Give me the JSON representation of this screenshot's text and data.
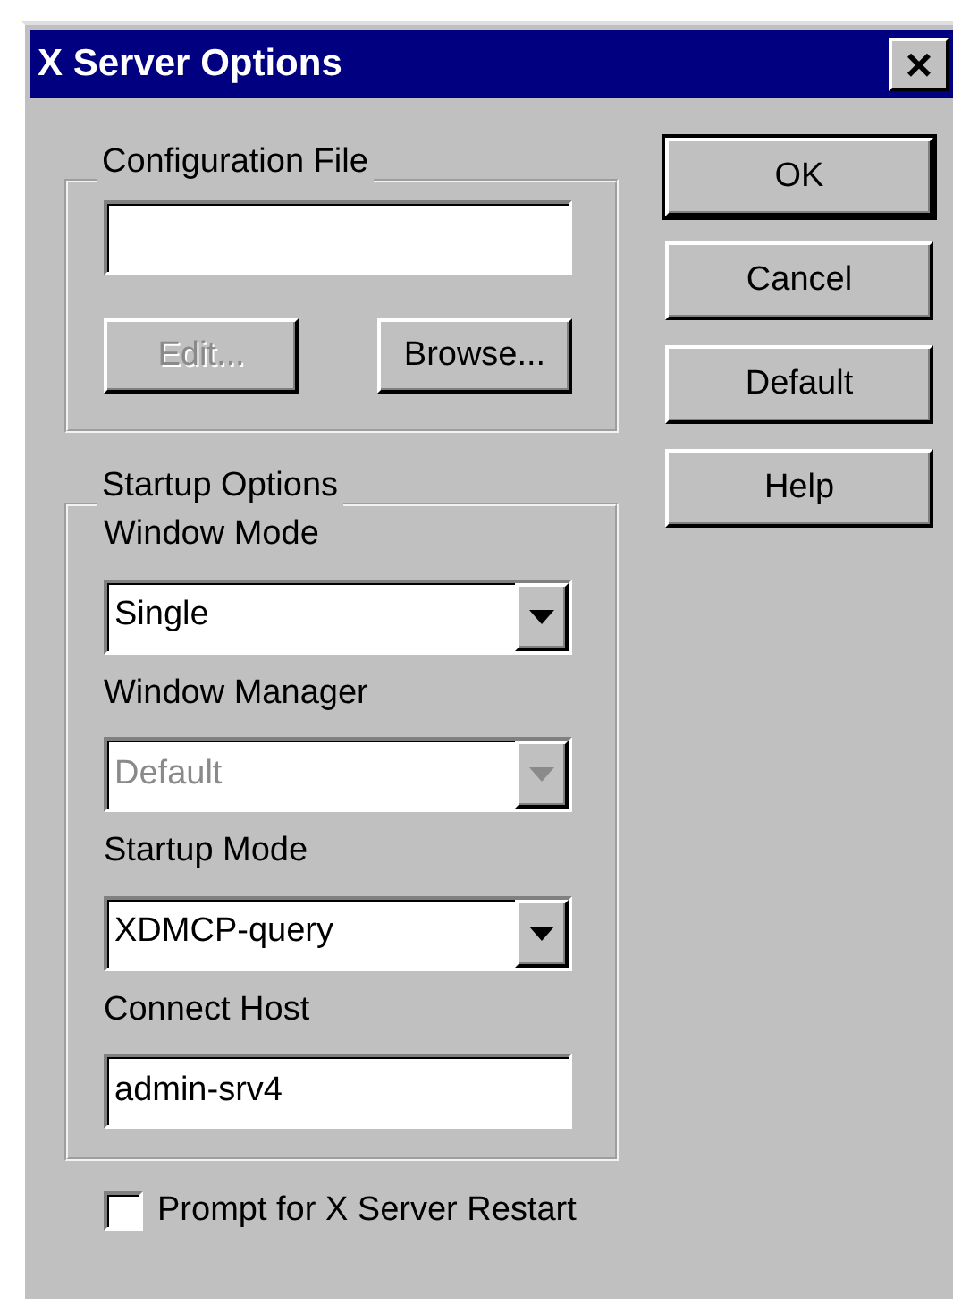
{
  "window": {
    "title": "X Server Options",
    "close": "×"
  },
  "configuration_file": {
    "legend": "Configuration File",
    "buttons": [
      {
        "label": "Edit...",
        "disabled": true
      },
      {
        "label": "Browse...",
        "disabled": false
      }
    ]
  },
  "dialog_buttons": [
    {
      "label": "OK",
      "default": true
    },
    {
      "label": "Cancel",
      "default": false
    },
    {
      "label": "Default",
      "default": false
    },
    {
      "label": "Help",
      "default": false
    }
  ],
  "startup_options": {
    "legend": "Startup Options",
    "fields": [
      {
        "kind": "select",
        "label": "Window Mode",
        "value": "Single",
        "disabled": false
      },
      {
        "kind": "select",
        "label": "Window Manager",
        "value": "Default",
        "disabled": true
      },
      {
        "kind": "select",
        "label": "Startup Mode",
        "value": "XDMCP-query",
        "disabled": false
      },
      {
        "kind": "text",
        "label": "Connect Host",
        "value": "admin-srv4",
        "disabled": false
      }
    ]
  },
  "prompt_restart": {
    "label": "Prompt for X Server Restart",
    "checked": false
  }
}
